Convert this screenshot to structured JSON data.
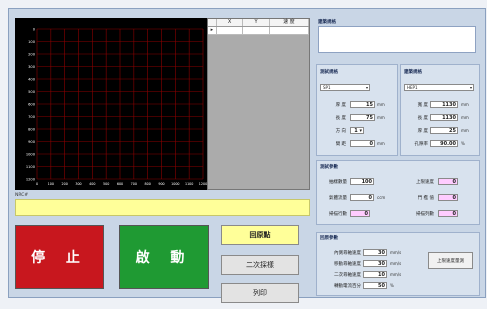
{
  "buttons": {
    "stop": "停 止",
    "start": "啟 動",
    "return": "回原點",
    "record": "二次採樣",
    "print": "列印"
  },
  "chart": {
    "y_ticks": [
      "0",
      "100",
      "200",
      "300",
      "400",
      "500",
      "600",
      "700",
      "800",
      "900",
      "1000",
      "1100",
      "1200"
    ],
    "x_ticks": [
      "0",
      "100",
      "200",
      "300",
      "400",
      "500",
      "600",
      "700",
      "800",
      "900",
      "1000",
      "1100",
      "1200"
    ],
    "colors": {
      "background": "#000000",
      "grid": "#8b0000"
    }
  },
  "table": {
    "headers": [
      "",
      "X",
      "Y",
      "速 度"
    ],
    "rows": [
      [
        "▸",
        "",
        "",
        ""
      ]
    ]
  },
  "message": {
    "label": "NRC#"
  },
  "note": {
    "title": "建築規格"
  },
  "section1": {
    "title": "測試規格",
    "select": "SP1",
    "fields": [
      {
        "label": "厚 度",
        "value": "15",
        "unit": "mm"
      },
      {
        "label": "長 度",
        "value": "75",
        "unit": "mm"
      },
      {
        "label": "方 向",
        "value": "1 ▾",
        "unit": ""
      },
      {
        "label": "間 距",
        "value": "0",
        "unit": "mm"
      }
    ]
  },
  "section2": {
    "title": "建築規格",
    "select": "HEP1",
    "fields": [
      {
        "label": "寬 度",
        "value": "1130",
        "unit": "mm"
      },
      {
        "label": "長 度",
        "value": "1130",
        "unit": "mm"
      },
      {
        "label": "厚 度",
        "value": "25",
        "unit": "mm"
      },
      {
        "label": "孔隙率",
        "value": "90.00",
        "unit": "%"
      }
    ]
  },
  "params": {
    "title": "測試參數",
    "rows": [
      {
        "label": "抽樣數量",
        "value": "100",
        "unit": "",
        "label2": "上限速度",
        "value2": "0"
      },
      {
        "label": "氣體流量",
        "value": "0",
        "unit": "ccm",
        "label2": "門 檻 值",
        "value2": "0"
      },
      {
        "label": "掃描行數",
        "value": "0",
        "unit": "",
        "label2": "掃描列數",
        "value2": "0"
      }
    ]
  },
  "motion": {
    "title": "回原參數",
    "rows": [
      {
        "label": "內側尋軸速度",
        "value": "30",
        "unit": "mm/s"
      },
      {
        "label": "移動尋軸速度",
        "value": "30",
        "unit": "mm/s"
      },
      {
        "label": "二次尋軸速度",
        "value": "10",
        "unit": "mm/s"
      },
      {
        "label": "轉動電流百分",
        "value": "50",
        "unit": "%"
      }
    ],
    "auto_btn": "上限速度量測"
  }
}
